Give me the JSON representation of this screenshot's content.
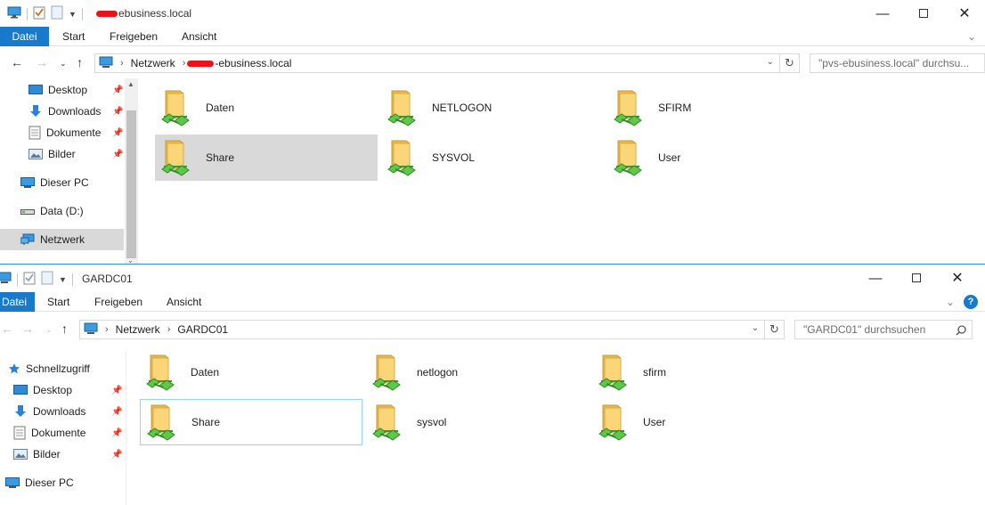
{
  "window1": {
    "title_suffix": "ebusiness.local",
    "tabs": [
      "Datei",
      "Start",
      "Freigeben",
      "Ansicht"
    ],
    "address": {
      "root": "Netzwerk",
      "host_suffix": "-ebusiness.local"
    },
    "search_placeholder": "\"pvs-ebusiness.local\" durchsu...",
    "sidebar": [
      {
        "label": "Desktop",
        "icon": "desktop-icon",
        "pinned": true
      },
      {
        "label": "Downloads",
        "icon": "downloads-icon",
        "pinned": true
      },
      {
        "label": "Dokumente",
        "icon": "documents-icon",
        "pinned": true
      },
      {
        "label": "Bilder",
        "icon": "pictures-icon",
        "pinned": true
      },
      {
        "label": "Dieser PC",
        "icon": "this-pc-icon",
        "pinned": false
      },
      {
        "label": "Data (D:)",
        "icon": "drive-icon",
        "pinned": false
      },
      {
        "label": "Netzwerk",
        "icon": "network-icon",
        "pinned": false,
        "selected": true
      }
    ],
    "shares": [
      "Daten",
      "NETLOGON",
      "SFIRM",
      "Share",
      "SYSVOL",
      "User"
    ]
  },
  "window2": {
    "title": "GARDC01",
    "tabs": [
      "Datei",
      "Start",
      "Freigeben",
      "Ansicht"
    ],
    "address": {
      "root": "Netzwerk",
      "host": "GARDC01"
    },
    "search_placeholder": "\"GARDC01\" durchsuchen",
    "sidebar": [
      {
        "label": "Schnellzugriff",
        "icon": "quick-access-icon",
        "pinned": false
      },
      {
        "label": "Desktop",
        "icon": "desktop-icon",
        "pinned": true
      },
      {
        "label": "Downloads",
        "icon": "downloads-icon",
        "pinned": true
      },
      {
        "label": "Dokumente",
        "icon": "documents-icon",
        "pinned": true
      },
      {
        "label": "Bilder",
        "icon": "pictures-icon",
        "pinned": true
      },
      {
        "label": "Dieser PC",
        "icon": "this-pc-icon",
        "pinned": false
      }
    ],
    "shares": [
      "Daten",
      "netlogon",
      "sfirm",
      "Share",
      "sysvol",
      "User"
    ]
  },
  "colors": {
    "accent": "#1979ca",
    "selection": "#d9d9d9",
    "focus_border": "#99d1ff"
  }
}
